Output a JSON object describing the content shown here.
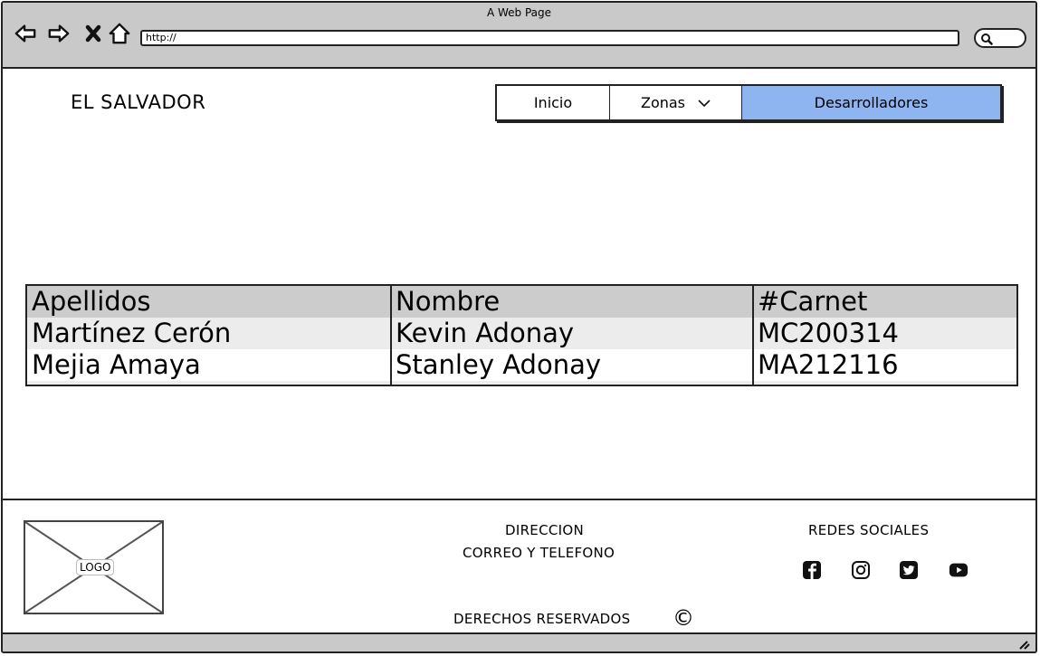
{
  "window": {
    "title": "A Web Page",
    "url": "http://"
  },
  "header": {
    "brand": "EL SALVADOR"
  },
  "nav": {
    "items": [
      {
        "label": "Inicio"
      },
      {
        "label": "Zonas"
      },
      {
        "label": "Desarrolladores"
      }
    ],
    "active_color": "#8fb5f0"
  },
  "table": {
    "headers": [
      "Apellidos",
      "Nombre",
      "#Carnet"
    ],
    "rows": [
      [
        "Martínez Cerón",
        "Kevin Adonay",
        "MC200314"
      ],
      [
        "Mejia Amaya",
        "Stanley Adonay",
        "MA212116"
      ]
    ]
  },
  "footer": {
    "logo": "LOGO",
    "direccion": "DIRECCION",
    "contacto": "CORREO Y TELEFONO",
    "redes": "REDES SOCIALES",
    "derechos": "DERECHOS RESERVADOS",
    "copyright_symbol": "©",
    "social_icons": [
      "facebook-icon",
      "instagram-icon",
      "twitter-icon",
      "youtube-icon"
    ]
  }
}
